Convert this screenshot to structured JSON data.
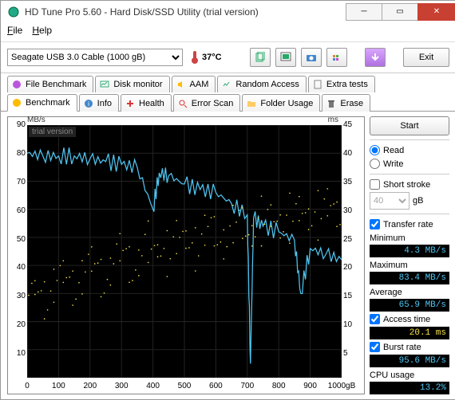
{
  "title": "HD Tune Pro 5.60 - Hard Disk/SSD Utility (trial version)",
  "menu": {
    "file": "File",
    "help": "Help"
  },
  "toolbar": {
    "drive": "Seagate USB 3.0 Cable (1000 gB)",
    "temp": "37°C",
    "exit": "Exit"
  },
  "tabs_top": {
    "file_benchmark": "File Benchmark",
    "disk_monitor": "Disk monitor",
    "aam": "AAM",
    "random_access": "Random Access",
    "extra_tests": "Extra tests"
  },
  "tabs_bottom": {
    "benchmark": "Benchmark",
    "info": "Info",
    "health": "Health",
    "error_scan": "Error Scan",
    "folder_usage": "Folder Usage",
    "erase": "Erase"
  },
  "sidebar": {
    "start": "Start",
    "read": "Read",
    "write": "Write",
    "short_stroke": "Short stroke",
    "short_stroke_val": "40",
    "short_stroke_unit": "gB",
    "transfer_rate": "Transfer rate",
    "minimum_lbl": "Minimum",
    "minimum_val": "4.3 MB/s",
    "maximum_lbl": "Maximum",
    "maximum_val": "83.4 MB/s",
    "average_lbl": "Average",
    "average_val": "65.9 MB/s",
    "access_time": "Access time",
    "access_time_val": "20.1 ms",
    "burst_rate": "Burst rate",
    "burst_rate_val": "95.6 MB/s",
    "cpu_usage": "CPU usage",
    "cpu_usage_val": "13.2%"
  },
  "chart": {
    "ylabel_left": "MB/s",
    "ylabel_right": "ms",
    "watermark": "trial version",
    "xunit": "1000gB"
  },
  "chart_data": {
    "type": "line",
    "title": "",
    "xlabel": "gB",
    "ylabel_left": "MB/s",
    "ylabel_right": "ms",
    "x_ticks": [
      0,
      100,
      200,
      300,
      400,
      500,
      600,
      700,
      800,
      900,
      1000
    ],
    "y_ticks_left": [
      10,
      20,
      30,
      40,
      50,
      60,
      70,
      80,
      90
    ],
    "y_ticks_right": [
      5,
      10,
      15,
      20,
      25,
      30,
      35,
      40,
      45
    ],
    "xlim": [
      0,
      1000
    ],
    "ylim_left": [
      0,
      90
    ],
    "ylim_right": [
      0,
      45
    ],
    "series": [
      {
        "name": "Transfer rate (MB/s)",
        "axis": "left",
        "color": "#4fc6f2",
        "x": [
          0,
          50,
          100,
          150,
          200,
          250,
          300,
          350,
          400,
          420,
          450,
          500,
          550,
          600,
          650,
          700,
          710,
          720,
          750,
          800,
          850,
          870,
          900,
          950,
          1000
        ],
        "values": [
          80,
          79,
          79,
          79,
          78,
          77,
          76,
          75,
          60,
          73,
          72,
          69,
          67,
          66,
          62,
          58,
          5,
          57,
          54,
          52,
          49,
          30,
          46,
          44,
          42
        ]
      },
      {
        "name": "Access time (ms)",
        "axis": "right",
        "color": "#f7e24a",
        "type": "scatter",
        "x": [
          10,
          40,
          70,
          100,
          130,
          160,
          190,
          220,
          250,
          280,
          310,
          340,
          370,
          400,
          430,
          460,
          490,
          520,
          550,
          580,
          610,
          640,
          670,
          700,
          730,
          760,
          790,
          820,
          850,
          880,
          910,
          940,
          970,
          1000
        ],
        "values": [
          14,
          16,
          15,
          17,
          18,
          17,
          19,
          20,
          18,
          21,
          22,
          20,
          23,
          22,
          24,
          23,
          24,
          25,
          24,
          26,
          25,
          26,
          27,
          26,
          28,
          27,
          28,
          29,
          28,
          29,
          30,
          29,
          30,
          30
        ]
      }
    ]
  }
}
